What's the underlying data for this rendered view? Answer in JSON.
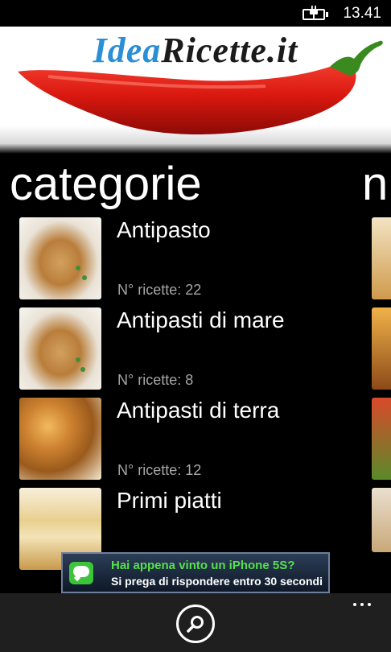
{
  "status": {
    "time": "13.41",
    "battery_icon": "battery-charging-icon"
  },
  "banner": {
    "logo_part1": "Idea",
    "logo_part2": "Ricette.it",
    "image": "red-chili-pepper"
  },
  "pivot": {
    "header": "categorie",
    "next_header": "n"
  },
  "categories": [
    {
      "title": "Antipasto",
      "count": "N° ricette: 22",
      "thumb": "chicken-dish"
    },
    {
      "title": "Antipasti di mare",
      "count": "N° ricette: 8",
      "thumb": "chicken-dish"
    },
    {
      "title": "Antipasti di terra",
      "count": "N° ricette: 12",
      "thumb": "croissants"
    },
    {
      "title": "Primi piatti",
      "count": "",
      "thumb": "lasagna"
    }
  ],
  "ad": {
    "title": "Hai appena vinto un iPhone 5S?",
    "subtitle": "Si prega di rispondere entro 30 secondi",
    "icon": "message-icon",
    "colors": {
      "title": "#56e04b",
      "background": "#1a2638"
    }
  },
  "appbar": {
    "search_icon": "search-icon",
    "more_icon": "more-icon",
    "background": "#1f1f1f"
  }
}
